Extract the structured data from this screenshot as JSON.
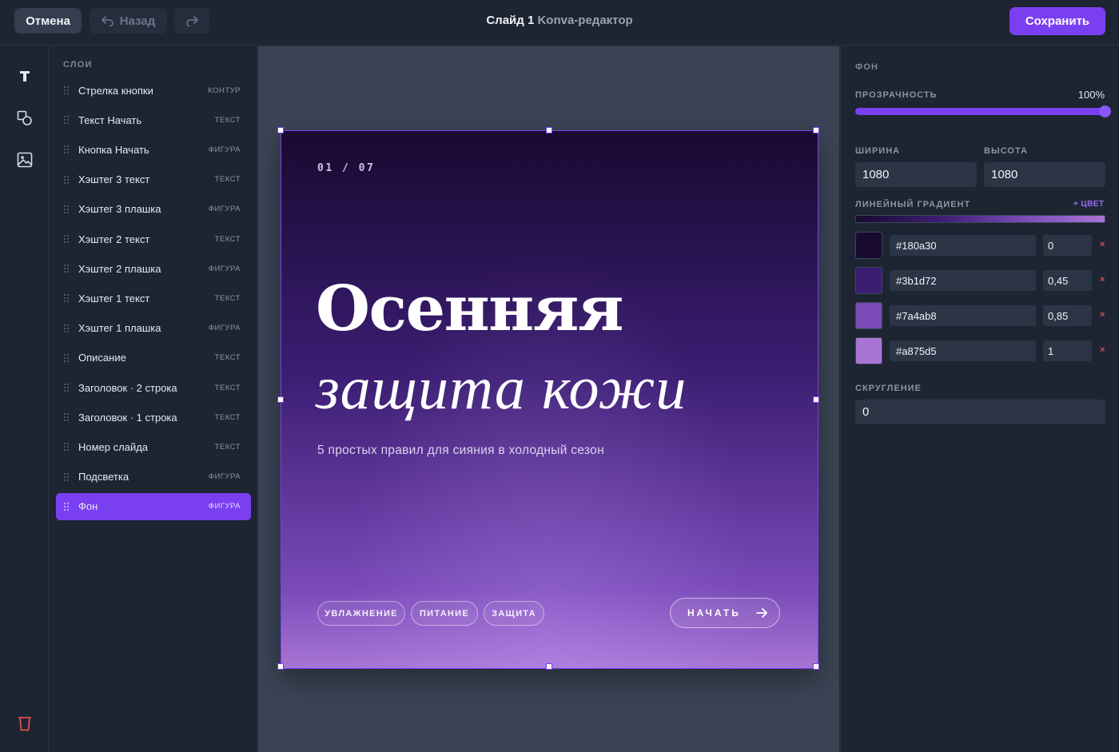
{
  "topbar": {
    "cancel_label": "Отмена",
    "back_label": "Назад",
    "title_main": "Слайд 1",
    "title_sub": "Konva-редактор",
    "save_label": "Сохранить"
  },
  "tools": [
    {
      "name": "text-tool",
      "icon": "text-T-icon"
    },
    {
      "name": "shapes-tool",
      "icon": "shapes-icon"
    },
    {
      "name": "image-tool",
      "icon": "image-icon"
    },
    {
      "name": "delete-tool",
      "icon": "trash-icon"
    }
  ],
  "layers": {
    "heading": "СЛОИ",
    "items": [
      {
        "label": "Стрелка кнопки",
        "type": "КОНТУР"
      },
      {
        "label": "Текст Начать",
        "type": "ТЕКСТ"
      },
      {
        "label": "Кнопка Начать",
        "type": "ФИГУРА"
      },
      {
        "label": "Хэштег 3 текст",
        "type": "ТЕКСТ"
      },
      {
        "label": "Хэштег 3 плашка",
        "type": "ФИГУРА"
      },
      {
        "label": "Хэштег 2 текст",
        "type": "ТЕКСТ"
      },
      {
        "label": "Хэштег 2 плашка",
        "type": "ФИГУРА"
      },
      {
        "label": "Хэштег 1 текст",
        "type": "ТЕКСТ"
      },
      {
        "label": "Хэштег 1 плашка",
        "type": "ФИГУРА"
      },
      {
        "label": "Описание",
        "type": "ТЕКСТ"
      },
      {
        "label": "Заголовок · 2 строка",
        "type": "ТЕКСТ"
      },
      {
        "label": "Заголовок · 1 строка",
        "type": "ТЕКСТ"
      },
      {
        "label": "Номер слайда",
        "type": "ТЕКСТ"
      },
      {
        "label": "Подсветка",
        "type": "ФИГУРА"
      },
      {
        "label": "Фон",
        "type": "ФИГУРА",
        "active": true
      }
    ]
  },
  "slide": {
    "number": "01 / 07",
    "heading_line1": "Осенняя",
    "heading_line2": "защита кожи",
    "description": "5 простых правил для сияния в холодный сезон",
    "tags": [
      "УВЛАЖНЕНИЕ",
      "ПИТАНИЕ",
      "ЗАЩИТА"
    ],
    "cta_label": "НАЧАТЬ"
  },
  "properties": {
    "section": "ФОН",
    "opacity_label": "ПРОЗРАЧНОСТЬ",
    "opacity_value": "100%",
    "opacity_fraction": 1.0,
    "width_label": "ШИРИНА",
    "width_value": "1080",
    "height_label": "ВЫСОТА",
    "height_value": "1080",
    "gradient_label": "ЛИНЕЙНЫЙ ГРАДИЕНТ",
    "add_color_label": "+ ЦВЕТ",
    "stops": [
      {
        "color": "#180a30",
        "offset": "0"
      },
      {
        "color": "#3b1d72",
        "offset": "0,45"
      },
      {
        "color": "#7a4ab8",
        "offset": "0,85"
      },
      {
        "color": "#a875d5",
        "offset": "1"
      }
    ],
    "delete_glyph": "×",
    "radius_label": "СКРУГЛЕНИЕ",
    "radius_value": "0"
  },
  "colors": {
    "accent": "#7b3ff2",
    "danger": "#e0524f"
  }
}
